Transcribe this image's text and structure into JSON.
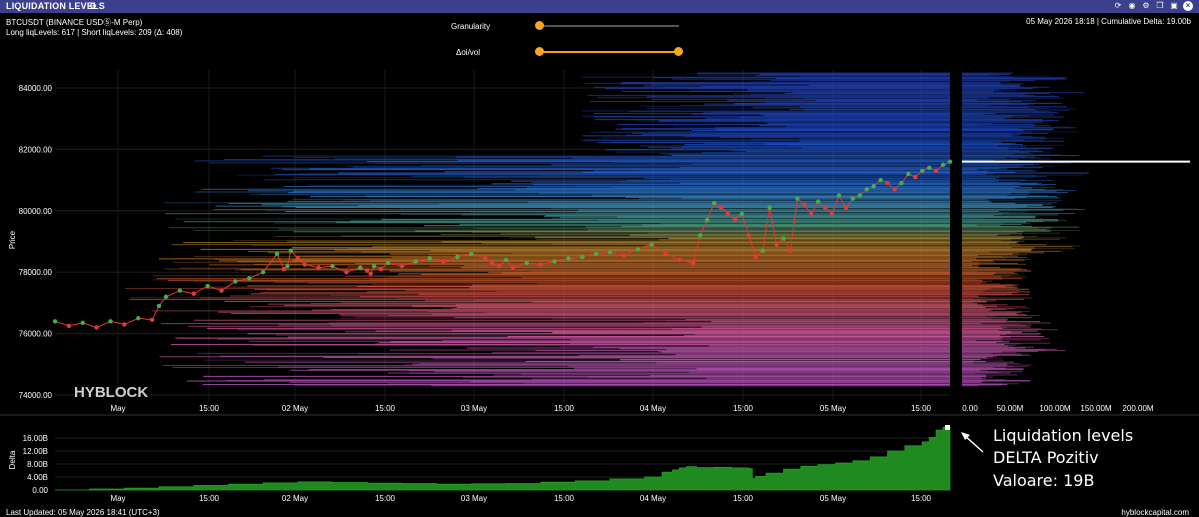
{
  "topbar": {
    "title": "LIQUIDATION LEVELS"
  },
  "info": {
    "symbol": "BTCUSDT (BINANCE USDⓈ-M Perp)",
    "levels": "Long liqLevels: 617 | Short liqLevels: 209 (Δ: 408)",
    "status": "05 May 2026 18:18 | Cumulative Delta: 19.00b"
  },
  "controls": {
    "granularity_label": "Granularity",
    "oivol_label": "Δoi/vol"
  },
  "chart_data": [
    {
      "type": "line",
      "ylabel": "Price",
      "ylim": [
        73800,
        84900
      ],
      "yticks": [
        "84000.00",
        "82000.00",
        "80000.00",
        "78000.00",
        "76000.00",
        "74000.00"
      ],
      "xticks": [
        "May",
        "15:00",
        "02 May",
        "15:00",
        "03 May",
        "15:00",
        "04 May",
        "15:00",
        "05 May",
        "15:00"
      ],
      "watermark": "HYBLOCK",
      "series": [
        {
          "x": [
            0,
            4,
            8,
            12,
            16,
            20,
            24,
            28,
            30,
            32,
            36,
            40,
            44,
            48,
            52,
            56,
            60,
            64,
            66,
            67,
            68,
            70,
            72,
            76,
            80,
            84,
            88,
            90,
            91,
            92,
            94,
            96,
            100,
            104,
            108,
            112,
            116,
            120,
            124,
            126,
            128,
            130,
            132,
            136,
            140,
            144,
            148,
            152,
            156,
            160,
            164,
            168,
            172,
            176,
            180,
            184,
            186,
            188,
            190,
            192,
            194,
            196,
            198,
            200,
            202,
            204,
            206,
            208,
            210,
            212,
            214,
            216,
            218,
            220,
            222,
            224,
            226,
            228,
            230,
            232,
            234,
            236,
            238,
            240,
            242,
            244,
            246,
            248,
            250,
            252,
            254,
            256,
            258
          ],
          "values": [
            76400,
            76250,
            76350,
            76200,
            76400,
            76300,
            76500,
            76450,
            76900,
            77200,
            77400,
            77300,
            77550,
            77400,
            77700,
            77800,
            78000,
            78600,
            78100,
            78200,
            78700,
            78450,
            78250,
            78150,
            78200,
            78000,
            78150,
            78050,
            77950,
            78200,
            78100,
            78300,
            78200,
            78350,
            78450,
            78350,
            78500,
            78600,
            78450,
            78300,
            78200,
            78400,
            78150,
            78300,
            78250,
            78350,
            78450,
            78500,
            78600,
            78650,
            78550,
            78750,
            78900,
            78600,
            78400,
            78300,
            79200,
            79700,
            80250,
            80100,
            79900,
            79700,
            79900,
            79200,
            78500,
            78700,
            80100,
            78900,
            79100,
            78700,
            80400,
            80200,
            79900,
            80300,
            80100,
            79900,
            80500,
            80100,
            80400,
            80500,
            80700,
            80800,
            81000,
            80900,
            80700,
            80900,
            81200,
            81100,
            81300,
            81400,
            81300,
            81500,
            81600
          ]
        }
      ]
    },
    {
      "type": "bar",
      "xticks": [
        "0.00",
        "50.00M",
        "100.00M",
        "150.00M",
        "200.00M"
      ],
      "marker_price": 81600
    },
    {
      "type": "area",
      "ylabel": "Delta",
      "ylim": [
        -1,
        20
      ],
      "yticks": [
        "16.00B",
        "12.00B",
        "8.00B",
        "4.00B",
        "0.00"
      ],
      "xticks": [
        "May",
        "15:00",
        "02 May",
        "15:00",
        "03 May",
        "15:00",
        "04 May",
        "15:00",
        "05 May",
        "15:00"
      ],
      "series": [
        {
          "x": [
            0,
            10,
            20,
            30,
            40,
            50,
            60,
            70,
            80,
            90,
            100,
            110,
            120,
            130,
            140,
            150,
            160,
            170,
            175,
            178,
            180,
            182,
            185,
            190,
            195,
            200,
            201,
            202,
            205,
            210,
            215,
            220,
            225,
            230,
            235,
            240,
            245,
            250,
            252,
            254,
            256,
            258
          ],
          "values": [
            0,
            0.3,
            0.6,
            1.0,
            1.4,
            1.8,
            2.2,
            2.5,
            2.3,
            2.1,
            2.0,
            1.8,
            1.9,
            2.0,
            2.4,
            2.8,
            3.4,
            4.0,
            5.5,
            6.2,
            6.8,
            7.2,
            6.9,
            7.0,
            6.8,
            6.6,
            3.5,
            4.2,
            5.2,
            6.4,
            7.3,
            7.8,
            8.3,
            9.0,
            10.2,
            12.0,
            13.6,
            14.8,
            16.2,
            18.4,
            19.3,
            19.0
          ]
        }
      ]
    }
  ],
  "annotation": {
    "line1": "Liquidation levels",
    "line2": "DELTA Pozitiv",
    "line3": "Valoare: 19B"
  },
  "footer": {
    "updated": "Last Updated: 05 May 2026 18:41 (UTC+3)",
    "site": "hyblockcapital.com"
  }
}
